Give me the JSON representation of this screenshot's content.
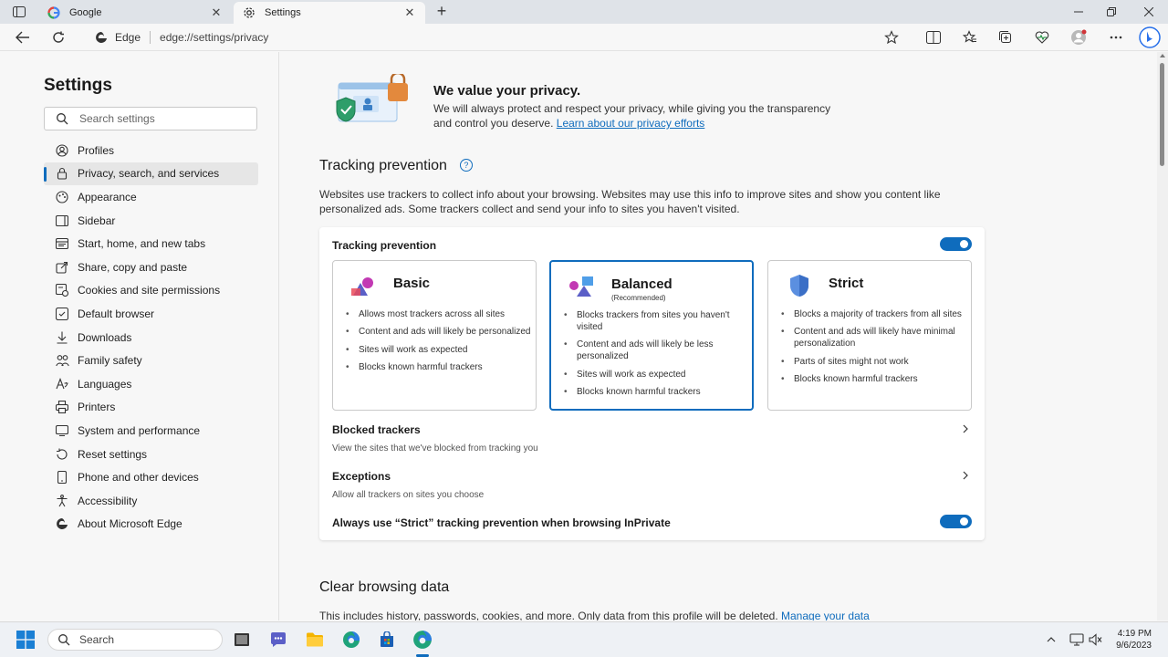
{
  "tabs": [
    {
      "title": "Google",
      "favicon": "google-icon",
      "active": false
    },
    {
      "title": "Settings",
      "favicon": "gear-icon",
      "active": true
    }
  ],
  "address_bar": {
    "brand": "Edge",
    "url": "edge://settings/privacy"
  },
  "sidebar": {
    "title": "Settings",
    "search_placeholder": "Search settings",
    "items": [
      {
        "label": "Profiles",
        "icon": "profile-icon"
      },
      {
        "label": "Privacy, search, and services",
        "icon": "lock-icon",
        "active": true
      },
      {
        "label": "Appearance",
        "icon": "appearance-icon"
      },
      {
        "label": "Sidebar",
        "icon": "sidebar-icon"
      },
      {
        "label": "Start, home, and new tabs",
        "icon": "home-tabs-icon"
      },
      {
        "label": "Share, copy and paste",
        "icon": "share-icon"
      },
      {
        "label": "Cookies and site permissions",
        "icon": "cookie-icon"
      },
      {
        "label": "Default browser",
        "icon": "browser-icon"
      },
      {
        "label": "Downloads",
        "icon": "download-icon"
      },
      {
        "label": "Family safety",
        "icon": "family-icon"
      },
      {
        "label": "Languages",
        "icon": "language-icon"
      },
      {
        "label": "Printers",
        "icon": "printer-icon"
      },
      {
        "label": "System and performance",
        "icon": "system-icon"
      },
      {
        "label": "Reset settings",
        "icon": "reset-icon"
      },
      {
        "label": "Phone and other devices",
        "icon": "phone-icon"
      },
      {
        "label": "Accessibility",
        "icon": "accessibility-icon"
      },
      {
        "label": "About Microsoft Edge",
        "icon": "edge-icon"
      }
    ]
  },
  "privacy_intro": {
    "title": "We value your privacy.",
    "desc_line1": "We will always protect and respect your privacy, while giving you the transparency",
    "desc_line2": "and control you deserve.",
    "link": "Learn about our privacy efforts"
  },
  "tracking": {
    "heading": "Tracking prevention",
    "help_icon": "?",
    "description": "Websites use trackers to collect info about your browsing. Websites may use this info to improve sites and show you content like personalized ads. Some trackers collect and send your info to sites you haven't visited.",
    "toggle_label": "Tracking prevention",
    "toggle_on": true,
    "options": [
      {
        "title": "Basic",
        "subtitle": "",
        "selected": false,
        "bullets": [
          "Allows most trackers across all sites",
          "Content and ads will likely be personalized",
          "Sites will work as expected",
          "Blocks known harmful trackers"
        ]
      },
      {
        "title": "Balanced",
        "subtitle": "(Recommended)",
        "selected": true,
        "bullets": [
          "Blocks trackers from sites you haven't visited",
          "Content and ads will likely be less personalized",
          "Sites will work as expected",
          "Blocks known harmful trackers"
        ]
      },
      {
        "title": "Strict",
        "subtitle": "",
        "selected": false,
        "bullets": [
          "Blocks a majority of trackers from all sites",
          "Content and ads will likely have minimal personalization",
          "Parts of sites might not work",
          "Blocks known harmful trackers"
        ]
      }
    ],
    "blocked": {
      "label": "Blocked trackers",
      "sub": "View the sites that we've blocked from tracking you"
    },
    "exceptions": {
      "label": "Exceptions",
      "sub": "Allow all trackers on sites you choose"
    },
    "inprivate": {
      "label": "Always use “Strict” tracking prevention when browsing InPrivate",
      "on": true
    }
  },
  "clear_browsing": {
    "heading": "Clear browsing data",
    "desc": "This includes history, passwords, cookies, and more. Only data from this profile will be deleted.",
    "link": "Manage your data"
  },
  "taskbar": {
    "search_placeholder": "Search",
    "time": "4:19 PM",
    "date": "9/6/2023"
  },
  "colors": {
    "accent": "#0f6cbd",
    "background": "#f7f7f7",
    "card": "#ffffff"
  }
}
